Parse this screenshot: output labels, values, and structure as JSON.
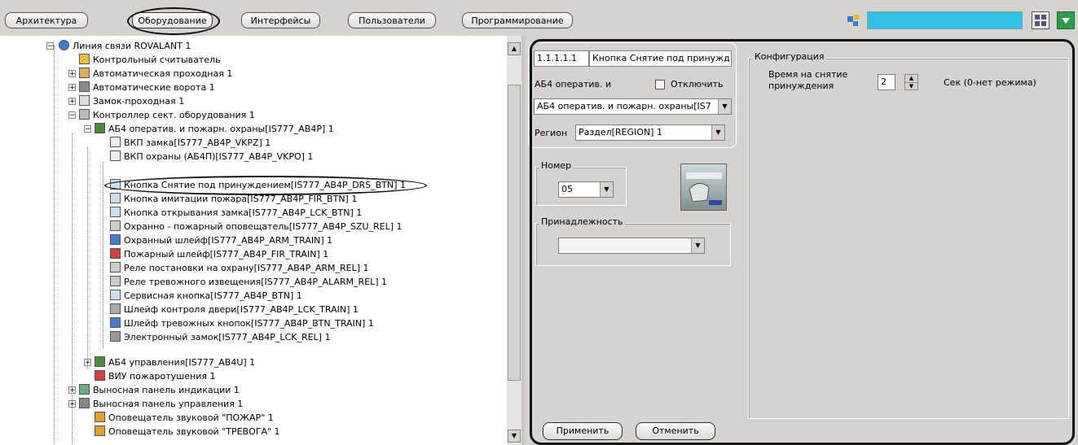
{
  "toolbar": {
    "tabs": [
      {
        "label": "Архитектура"
      },
      {
        "label": "Оборудование"
      },
      {
        "label": "Интерфейсы"
      },
      {
        "label": "Пользователи"
      },
      {
        "label": "Программирование"
      }
    ],
    "active_tab": "Оборудование",
    "search_value": "",
    "icons": [
      "network-icon",
      "grid-icon",
      "dropdown-arrow-icon"
    ]
  },
  "tree": {
    "items": [
      {
        "label": "Линия связи ROVALANT 1",
        "icon": "globe-icon"
      },
      {
        "label": "Контрольный считыватель",
        "icon": "reader-icon"
      },
      {
        "label": "Автоматическая проходная 1",
        "icon": "turnstile-icon"
      },
      {
        "label": "Автоматические ворота 1",
        "icon": "gate-icon"
      },
      {
        "label": "Замок-проходная 1",
        "icon": "lock-passage-icon"
      },
      {
        "label": "Контроллер сект. оборудования 1",
        "icon": "controller-icon"
      },
      {
        "label": "АБ4 оператив. и пожарн. охраны[IS777_AB4P] 1",
        "icon": "block-icon"
      },
      {
        "label": "ВКП замка[IS777_AB4P_VKPZ] 1",
        "icon": "switch-icon"
      },
      {
        "label": "ВКП охраны (АБ4П)[IS777_AB4P_VKPO] 1",
        "icon": "switch-icon"
      },
      {
        "label": "Кнопка Снятие под принуждением[IS777_AB4P_DRS_BTN] 1",
        "icon": "button-icon"
      },
      {
        "label": "Кнопка имитации пожара[IS777_AB4P_FIR_BTN] 1",
        "icon": "button-icon"
      },
      {
        "label": "Кнопка открывания замка[IS777_AB4P_LCK_BTN] 1",
        "icon": "button-icon"
      },
      {
        "label": "Охранно - пожарный оповещатель[IS777_AB4P_SZU_REL] 1",
        "icon": "relay-icon"
      },
      {
        "label": "Охранный шлейф[IS777_AB4P_ARM_TRAIN] 1",
        "icon": "loop-icon"
      },
      {
        "label": "Пожарный шлейф[IS777_AB4P_FIR_TRAIN] 1",
        "icon": "fire-loop-icon"
      },
      {
        "label": "Реле постановки на охрану[IS777_AB4P_ARM_REL] 1",
        "icon": "relay-icon"
      },
      {
        "label": "Реле тревожного извещения[IS777_AB4P_ALARM_REL] 1",
        "icon": "relay-icon"
      },
      {
        "label": "Сервисная кнопка[IS777_AB4P_BTN] 1",
        "icon": "button-icon"
      },
      {
        "label": "Шлейф контроля двери[IS777_AB4P_LCK_TRAIN] 1",
        "icon": "door-loop-icon"
      },
      {
        "label": "Шлейф тревожных кнопок[IS777_AB4P_BTN_TRAIN] 1",
        "icon": "loop-icon"
      },
      {
        "label": "Электронный замок[IS777_AB4P_LCK_REL] 1",
        "icon": "lock-icon"
      },
      {
        "label": "АБ4 управления[IS777_AB4U] 1",
        "icon": "block-icon"
      },
      {
        "label": "ВИУ пожаротушения 1",
        "icon": "extinguish-icon"
      },
      {
        "label": "Выносная панель индикации 1",
        "icon": "panel-icon"
      },
      {
        "label": "Выносная панель управления 1",
        "icon": "panel-icon"
      },
      {
        "label": "Оповещатель звуковой \"ПОЖАР\" 1",
        "icon": "siren-icon"
      },
      {
        "label": "Оповещатель звуковой \"ТРЕВОГА\" 1",
        "icon": "siren-icon"
      }
    ],
    "selected_index": 9
  },
  "settings": {
    "address_value": "1.1.1.1.1",
    "name_value": "Кнопка Снятие под принужд",
    "parent_label": "АБ4 оператив. и",
    "disable_label": "Отключить",
    "disable_checked": false,
    "parent_combo_value": "АБ4 оператив. и пожарн. охраны[IS7",
    "region_label": "Регион",
    "region_value": "Раздел[REGION] 1",
    "number_group_title": "Номер",
    "number_value": "05",
    "belong_group_title": "Принадлежность",
    "belong_value": "",
    "config_group_title": "Конфигурация",
    "time_label_line1": "Время на снятие",
    "time_label_line2": "принуждения",
    "time_value": "2",
    "time_unit": "Сек (0-нет режима)",
    "apply_button": "Применить",
    "cancel_button": "Отменить"
  },
  "colors": {
    "toolbar_bg": "#d6d3ce",
    "search_bg": "#33c0e6",
    "panel_bg": "#d6d3ce"
  }
}
